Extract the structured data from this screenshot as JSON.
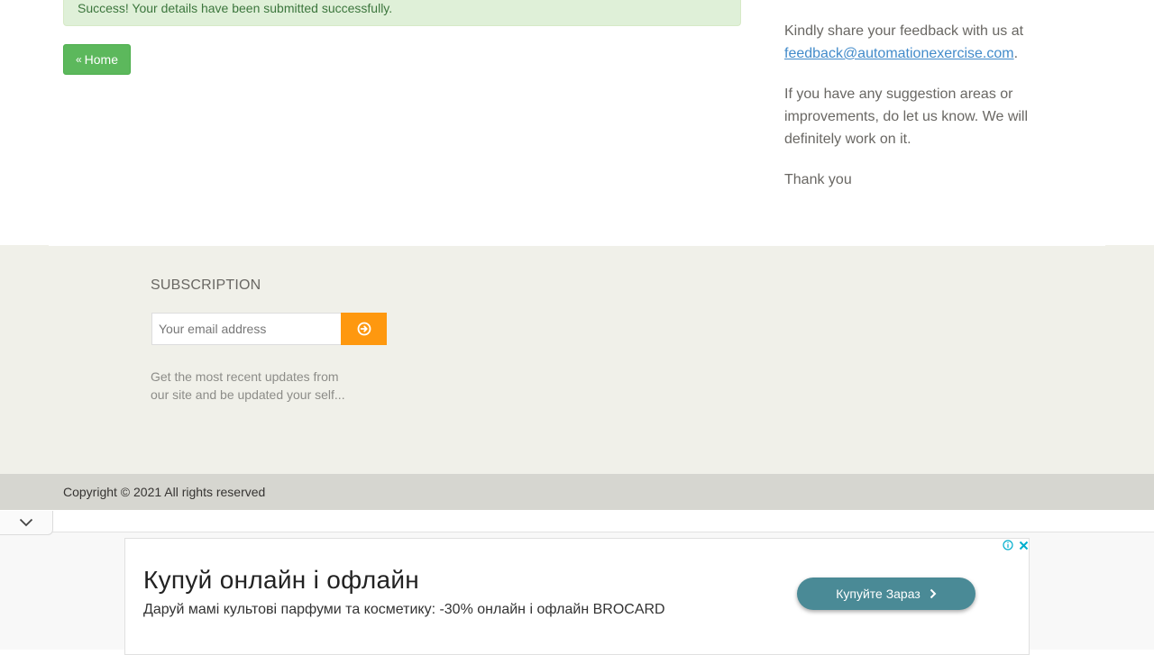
{
  "alert": {
    "text": "Success! Your details have been submitted successfully."
  },
  "home_button": {
    "label": "Home",
    "icon": "double-chevron-left-icon"
  },
  "feedback": {
    "intro": "Kindly share your feedback with us at",
    "email": "feedback@automationexercise.com",
    "period": ".",
    "suggestion": "If you have any suggestion areas or improvements, do let us know. We will definitely work on it.",
    "thanks": "Thank you"
  },
  "subscription": {
    "title": "SUBSCRIPTION",
    "placeholder": "Your email address",
    "button_icon": "arrow-circle-right-icon",
    "description": "Get the most recent updates from our site and be updated your self..."
  },
  "footer": {
    "copyright": "Copyright © 2021 All rights reserved"
  },
  "ad": {
    "headline": "Купуй онлайн і офлайн",
    "subtext": "Даруй мамі культові парфуми та косметику: -30% онлайн і офлайн BROCARD",
    "cta_label": "Купуйте Зараз",
    "cta_color": "#4a8a96"
  },
  "colors": {
    "accent_orange": "#fe980f",
    "success_green": "#5cb85c",
    "link_blue": "#428bca",
    "footer_bg": "#f0f0e9"
  }
}
